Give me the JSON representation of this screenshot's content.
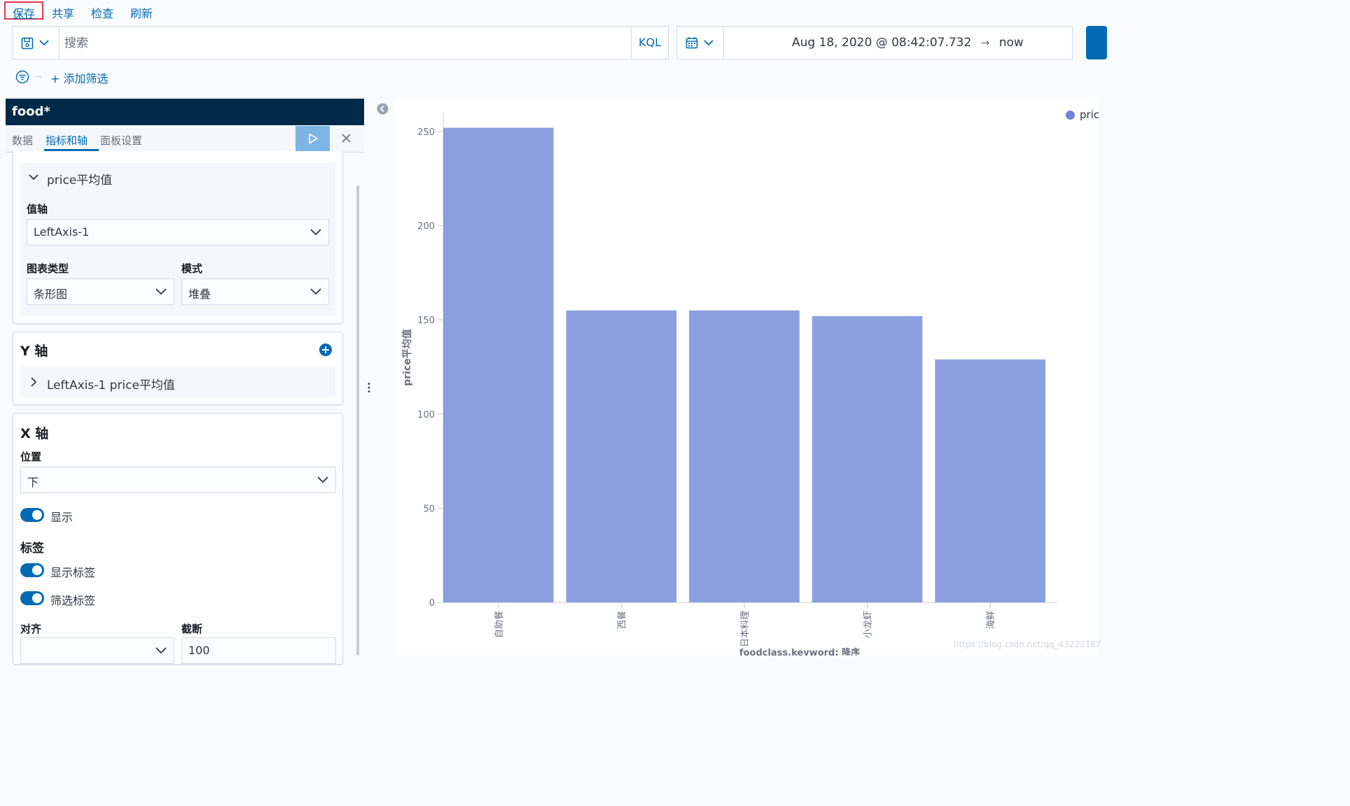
{
  "top_menu": {
    "save": "保存",
    "share": "共享",
    "inspect": "检查",
    "refresh": "刷新"
  },
  "query_bar": {
    "placeholder": "搜索",
    "kql": "KQL"
  },
  "date_picker": {
    "start": "Aug 18, 2020 @ 08:42:07.732",
    "arrow": "→",
    "end": "now"
  },
  "filter": {
    "add_label": "+ 添加筛选"
  },
  "sidebar": {
    "index_pattern": "food*",
    "tabs": [
      "数据",
      "指标和轴",
      "面板设置"
    ],
    "active_tab": 1,
    "metric_panel": {
      "title": "price平均值",
      "value_axis_label": "值轴",
      "value_axis_value": "LeftAxis-1",
      "chart_type_label": "图表类型",
      "chart_type_value": "条形图",
      "mode_label": "模式",
      "mode_value": "堆叠"
    },
    "y_axis_panel": {
      "title": "Y 轴",
      "item": "LeftAxis-1 price平均值"
    },
    "x_axis_panel": {
      "title": "X 轴",
      "position_label": "位置",
      "position_value": "下",
      "show_label": "显示",
      "labels_heading": "标签",
      "show_labels": "显示标签",
      "filter_labels": "筛选标签",
      "align_label": "对齐",
      "truncate_label": "截断",
      "truncate_value": "100"
    }
  },
  "chart_data": {
    "type": "bar",
    "categories": [
      "自助餐",
      "西餐",
      "日本料理",
      "小龙虾",
      "海鲜"
    ],
    "values": [
      252,
      155,
      155,
      152,
      129
    ],
    "ylabel": "price平均值",
    "xlabel": "foodclass.keyword: 降序",
    "ylim": [
      0,
      260
    ],
    "yticks": [
      0,
      50,
      100,
      150,
      200,
      250
    ],
    "legend": "pric",
    "bar_color": "#8b9fe0"
  },
  "watermark": "https://blog.csdn.net/qq_43222167"
}
